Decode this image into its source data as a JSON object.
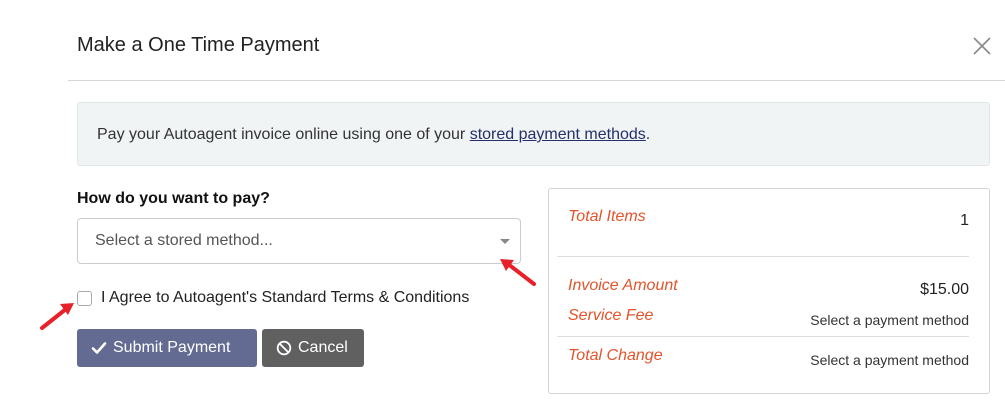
{
  "modal": {
    "title": "Make a One Time Payment"
  },
  "banner": {
    "text_before": "Pay your Autoagent invoice online using one of your ",
    "link_text": "stored payment methods",
    "text_after": "."
  },
  "form": {
    "pay_label": "How do you want to pay?",
    "select_placeholder": "Select a stored method...",
    "agree_label": "I Agree to Autoagent's Standard Terms & Conditions",
    "agree_checked": false
  },
  "buttons": {
    "submit_label": "Submit Payment",
    "cancel_label": "Cancel"
  },
  "summary": {
    "total_items_label": "Total Items",
    "total_items_value": "1",
    "invoice_amount_label": "Invoice Amount",
    "invoice_amount_value": "$15.00",
    "service_fee_label": "Service Fee",
    "service_fee_value": "Select a payment method",
    "total_change_label": "Total Change",
    "total_change_value": "Select a payment method"
  },
  "colors": {
    "accent_label": "#e2542b",
    "submit_button": "#646b93",
    "cancel_button": "#5f605f",
    "annotation_arrow": "#e8202a"
  },
  "icons": {
    "close": "close-icon",
    "caret": "caret-down-icon",
    "submit": "check-icon",
    "cancel": "ban-icon"
  }
}
